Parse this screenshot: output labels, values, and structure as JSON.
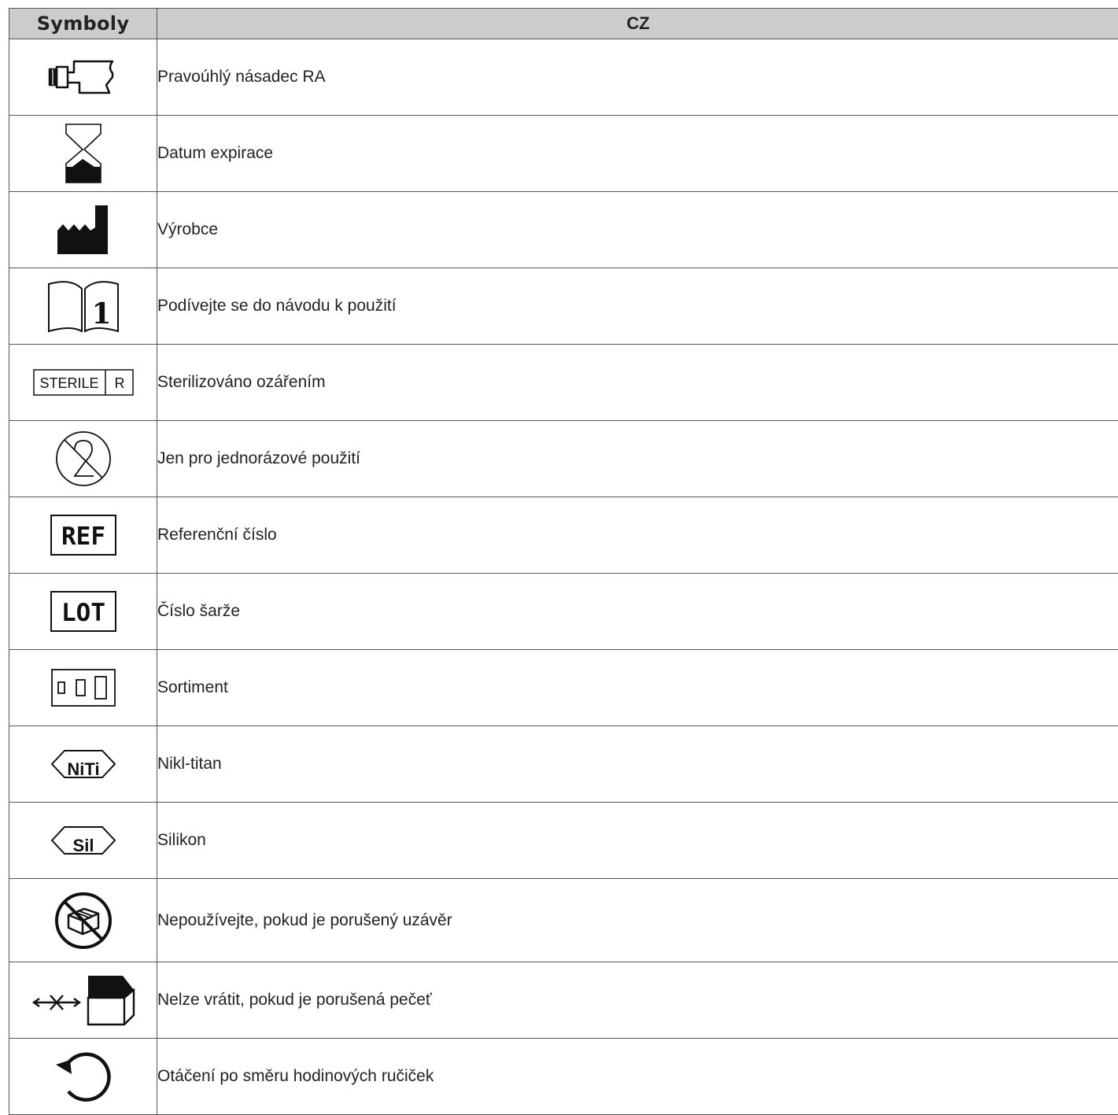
{
  "header": {
    "symbols": "Symboly",
    "lang": "CZ"
  },
  "rows": [
    {
      "icon": "ra-handpiece-icon",
      "label": "Pravoúhlý násadec RA"
    },
    {
      "icon": "hourglass-icon",
      "label": "Datum expirace"
    },
    {
      "icon": "factory-icon",
      "label": "Výrobce"
    },
    {
      "icon": "book-info-icon",
      "label": "Podívejte se do návodu k použití"
    },
    {
      "icon": "sterile-r-icon",
      "label": "Sterilizováno ozářením",
      "icon_text": [
        "STERILE",
        "R"
      ]
    },
    {
      "icon": "single-use-icon",
      "label": "Jen pro jednorázové použití"
    },
    {
      "icon": "ref-icon",
      "label": "Referenční číslo",
      "icon_text": "REF"
    },
    {
      "icon": "lot-icon",
      "label": "Číslo šarže",
      "icon_text": "LOT"
    },
    {
      "icon": "assortment-icon",
      "label": "Sortiment"
    },
    {
      "icon": "niti-icon",
      "label": "Nikl-titan",
      "icon_text": "NiTi"
    },
    {
      "icon": "silicone-icon",
      "label": "Silikon",
      "icon_text": "Sil"
    },
    {
      "icon": "damaged-package-icon",
      "label": "Nepoužívejte, pokud je porušený uzávěr"
    },
    {
      "icon": "no-return-icon",
      "label": "Nelze vrátit, pokud je porušená pečeť"
    },
    {
      "icon": "clockwise-icon",
      "label": "Otáčení po směru hodinových ručiček"
    }
  ]
}
